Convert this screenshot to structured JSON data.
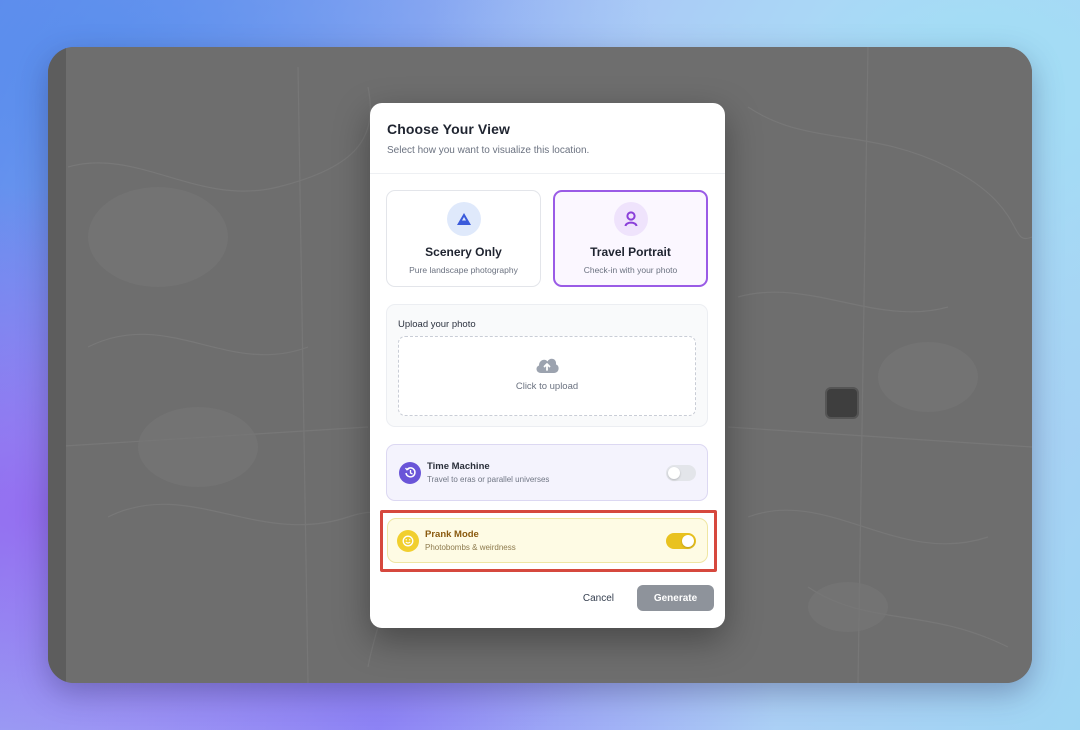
{
  "dialog": {
    "title": "Choose Your View",
    "subtitle": "Select how you want to visualize this location."
  },
  "view_options": [
    {
      "label": "Scenery Only",
      "description": "Pure landscape photography",
      "icon": "mountain-icon",
      "selected": false
    },
    {
      "label": "Travel Portrait",
      "description": "Check-in with your photo",
      "icon": "person-icon",
      "selected": true
    }
  ],
  "upload": {
    "label": "Upload your photo",
    "prompt": "Click to upload",
    "icon": "cloud-upload-icon"
  },
  "toggles": [
    {
      "title": "Time Machine",
      "description": "Travel to eras or parallel universes",
      "icon": "history-icon",
      "enabled": false
    },
    {
      "title": "Prank Mode",
      "description": "Photobombs & weirdness",
      "icon": "smiley-icon",
      "enabled": true
    }
  ],
  "footer": {
    "cancel_label": "Cancel",
    "generate_label": "Generate"
  },
  "colors": {
    "accent_purple": "#9a5be6",
    "time_machine_purple": "#6a55d8",
    "prank_yellow": "#e9c21f",
    "highlight_red": "#d6483e",
    "generate_gray": "#8e939b"
  }
}
